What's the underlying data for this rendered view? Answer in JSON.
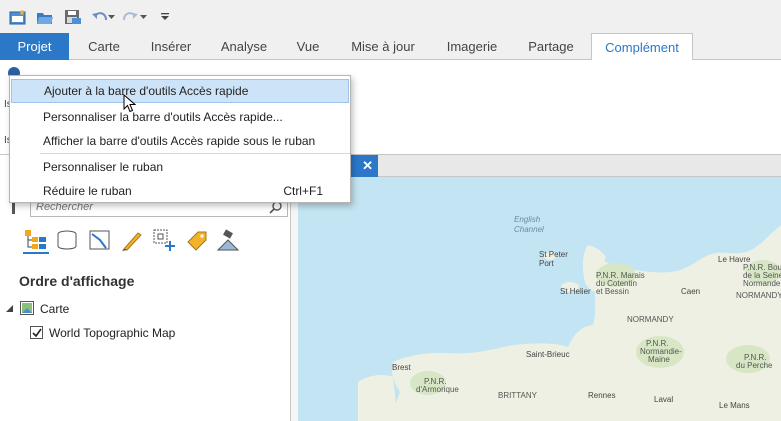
{
  "ribbon_tabs": {
    "projet": "Projet",
    "carte": "Carte",
    "inserer": "Insérer",
    "analyse": "Analyse",
    "vue": "Vue",
    "mise_a_jour": "Mise à jour",
    "imagerie": "Imagerie",
    "partage": "Partage",
    "complement": "Complément"
  },
  "context_menu": {
    "items": [
      {
        "label": "Ajouter à la barre d'outils Accès rapide",
        "shortcut": ""
      },
      {
        "label": "Personnaliser la barre d'outils Accès rapide...",
        "shortcut": ""
      },
      {
        "label": "Afficher la barre d'outils Accès rapide sous le ruban",
        "shortcut": ""
      },
      {
        "label": "Personnaliser le ruban",
        "shortcut": ""
      },
      {
        "label": "Réduire le ruban",
        "shortcut": "Ctrl+F1"
      }
    ],
    "highlighted_index": 0
  },
  "ribbon_fragments": {
    "label_a": "Is",
    "label_b": "Is"
  },
  "contents": {
    "search_placeholder": "Rechercher",
    "drawing_order_title": "Ordre d'affichage",
    "map_node": "Carte",
    "layer": "World Topographic Map",
    "layer_checked": true
  },
  "map_view": {
    "tab_close": "✕",
    "labels": {
      "english_channel_1": "English",
      "english_channel_2": "Channel",
      "st_peter_1": "St Peter",
      "st_peter_2": "Port",
      "st_helier": "St Helier",
      "pnr_marais_1": "P.N.R. Marais",
      "pnr_marais_2": "du Cotentin",
      "pnr_marais_3": "et Bessin",
      "le_havre": "Le Havre",
      "pnr_boucles_1": "P.N.R. Boucles",
      "pnr_boucles_2": "de la Seine",
      "pnr_boucles_3": "Normande",
      "caen": "Caen",
      "normandy_1": "NORMANDY",
      "normandy_2": "NORMANDY",
      "saint_brieuc": "Saint-Brieuc",
      "pnr_normandie_1": "P.N.R.",
      "pnr_normandie_2": "Normandie-",
      "pnr_normandie_3": "Maine",
      "pnr_perche_1": "P.N.R.",
      "pnr_perche_2": "du Perche",
      "brest": "Brest",
      "pnr_armorique_1": "P.N.R.",
      "pnr_armorique_2": "d'Armorique",
      "brittany": "BRITTANY",
      "rennes": "Rennes",
      "laval": "Laval",
      "le_mans": "Le Mans"
    }
  },
  "colors": {
    "accent": "#2b78c9",
    "sea": "#c3e4f2",
    "land": "#eef0e4",
    "park": "#d7e6c4",
    "menu_highlight": "#cde3f7"
  }
}
